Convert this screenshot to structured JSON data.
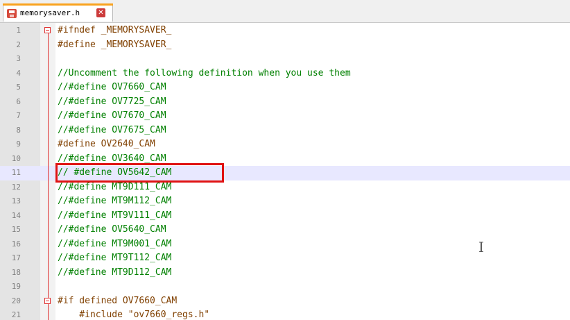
{
  "tab": {
    "filename": "memorysaver.h",
    "close_glyph": "✕",
    "save_icon": "save-icon"
  },
  "lines": [
    {
      "num": "1",
      "text": "#ifndef _MEMORYSAVER_",
      "kind": "pp",
      "fold": true
    },
    {
      "num": "2",
      "text": "#define _MEMORYSAVER_",
      "kind": "pp"
    },
    {
      "num": "3",
      "text": "",
      "kind": "pp"
    },
    {
      "num": "4",
      "text": "//Uncomment the following definition when you use them",
      "kind": "cm"
    },
    {
      "num": "5",
      "text": "//#define OV7660_CAM",
      "kind": "cm"
    },
    {
      "num": "6",
      "text": "//#define OV7725_CAM",
      "kind": "cm"
    },
    {
      "num": "7",
      "text": "//#define OV7670_CAM",
      "kind": "cm"
    },
    {
      "num": "8",
      "text": "//#define OV7675_CAM",
      "kind": "cm"
    },
    {
      "num": "9",
      "text": "#define OV2640_CAM",
      "kind": "pp"
    },
    {
      "num": "10",
      "text": "//#define OV3640_CAM",
      "kind": "cm"
    },
    {
      "num": "11",
      "text": "// #define OV5642_CAM",
      "kind": "cm",
      "current": true
    },
    {
      "num": "12",
      "text": "//#define MT9D111_CAM",
      "kind": "cm"
    },
    {
      "num": "13",
      "text": "//#define MT9M112_CAM",
      "kind": "cm"
    },
    {
      "num": "14",
      "text": "//#define MT9V111_CAM",
      "kind": "cm"
    },
    {
      "num": "15",
      "text": "//#define OV5640_CAM",
      "kind": "cm"
    },
    {
      "num": "16",
      "text": "//#define MT9M001_CAM",
      "kind": "cm"
    },
    {
      "num": "17",
      "text": "//#define MT9T112_CAM",
      "kind": "cm"
    },
    {
      "num": "18",
      "text": "//#define MT9D112_CAM",
      "kind": "cm"
    },
    {
      "num": "19",
      "text": "",
      "kind": "pp"
    },
    {
      "num": "20",
      "text": "#if defined OV7660_CAM",
      "kind": "pp",
      "fold": true
    },
    {
      "num": "21",
      "text": "    #include \"ov7660_regs.h\"",
      "kind": "pp"
    }
  ],
  "colors": {
    "preprocessor": "#804000",
    "comment": "#008000",
    "highlight": "#e01212",
    "fold_marker": "#e03030",
    "tab_accent": "#f9a21e"
  }
}
